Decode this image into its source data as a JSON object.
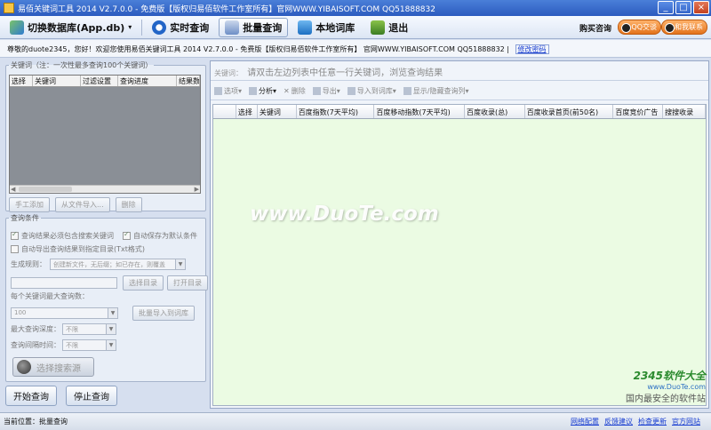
{
  "window": {
    "title": "易佰关键词工具 2014 V2.7.0.0 - 免费版【版权归易佰软件工作室所有】官网WWW.YIBAISOFT.COM QQ51888832",
    "controls": {
      "minimize": "_",
      "maximize": "□",
      "close": "×"
    }
  },
  "toolbar": {
    "switch_db": "切换数据库(App.db)",
    "realtime": "实时查询",
    "batch": "批量查询",
    "local": "本地词库",
    "exit": "退出",
    "buy_label": "购买咨询",
    "qq_label": "QQ交谈",
    "contact_label": "和我联系"
  },
  "welcome": {
    "text": "尊敬的duote2345，您好！欢迎您使用易佰关键词工具 2014 V2.7.0.0 - 免费版【版权归易佰软件工作室所有】 官网WWW.YIBAISOFT.COM QQ51888832  |",
    "link": "修改密码"
  },
  "left": {
    "keyword_group": {
      "legend": "关键词（注：一次性最多查询100个关键词）",
      "columns": [
        "选择",
        "关键词",
        "过滤设置",
        "查询进度",
        "结果数"
      ],
      "add_manual": "手工添加",
      "import_file": "从文件导入...",
      "delete": "删除"
    },
    "conditions": {
      "legend": "查询条件",
      "opt_contains": "查询结果必须包含搜索关键词",
      "opt_autosave": "自动保存为默认条件",
      "opt_export": "自动导出查询结果到指定目录(Txt格式)",
      "gen_rule_label": "生成规则：",
      "gen_rule_value": "创建新文件，无后缀；如已存在，则覆盖",
      "select_dir": "选择目录",
      "open_dir": "打开目录",
      "max_per_kw_label": "每个关键词最大查询数：",
      "max_per_kw_value": "100",
      "batch_import": "批量导入到词库",
      "max_depth_label": "最大查询深度：",
      "max_depth_value": "不限",
      "interval_label": "查询间隔时间：",
      "interval_value": "不限",
      "select_source": "选择搜索源"
    },
    "start": "开始查询",
    "stop": "停止查询"
  },
  "right": {
    "hint_prefix": "关键词：",
    "hint": "请双击左边列表中任意一行关键词，浏览查询结果",
    "subtoolbar": {
      "select": "选项",
      "analyze": "分析",
      "delete": "删除",
      "export": "导出",
      "import_to_lib": "导入到词库",
      "show_hide": "显示/隐藏查询列"
    },
    "columns": [
      "选择",
      "关键词",
      "百度指数(7天平均)",
      "百度移动指数(7天平均)",
      "百度收录(总)",
      "百度收录首页(前50名)",
      "百度竞价广告",
      "搜搜收录"
    ]
  },
  "watermark": "www.DuoTe.com",
  "logo": {
    "big": "2345软件大全",
    "small": "www.DuoTe.com",
    "tag": "国内最安全的软件站"
  },
  "status": {
    "location": "当前位置：批量查询",
    "links": [
      "网络配置",
      "反馈建议",
      "检查更新",
      "官方网站"
    ]
  }
}
